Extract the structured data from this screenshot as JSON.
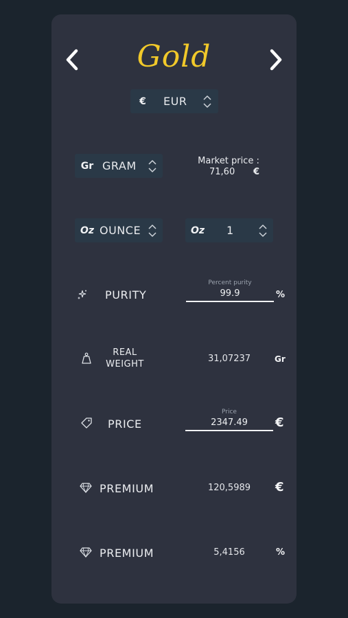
{
  "header": {
    "title": "Gold",
    "prev_icon": "chevron-left-icon",
    "next_icon": "chevron-right-icon"
  },
  "currency": {
    "symbol": "€",
    "value": "EUR"
  },
  "unit_select": {
    "prefix": "Gr",
    "value": "GRAM"
  },
  "market_price": {
    "label": "Market price :",
    "value": "71,60",
    "unit": "€"
  },
  "weight_unit_select": {
    "prefix": "Oz",
    "value": "OUNCE"
  },
  "quantity_select": {
    "prefix": "Oz",
    "value": "1"
  },
  "purity": {
    "label": "PURITY",
    "caption": "Percent purity",
    "value": "99.9",
    "unit": "%"
  },
  "real_weight": {
    "label_line1": "REAL",
    "label_line2": "WEIGHT",
    "value": "31,07237",
    "unit": "Gr"
  },
  "price": {
    "label": "PRICE",
    "caption": "Price",
    "value": "2347.49",
    "unit": "€"
  },
  "premium_eur": {
    "label": "PREMIUM",
    "value": "120,5989",
    "unit": "€"
  },
  "premium_pct": {
    "label": "PREMIUM",
    "value": "5,4156",
    "unit": "%"
  },
  "colors": {
    "background": "#1b242d",
    "card": "#2e323f",
    "select": "#2a3947",
    "accent_gold": "#f1c92a"
  }
}
